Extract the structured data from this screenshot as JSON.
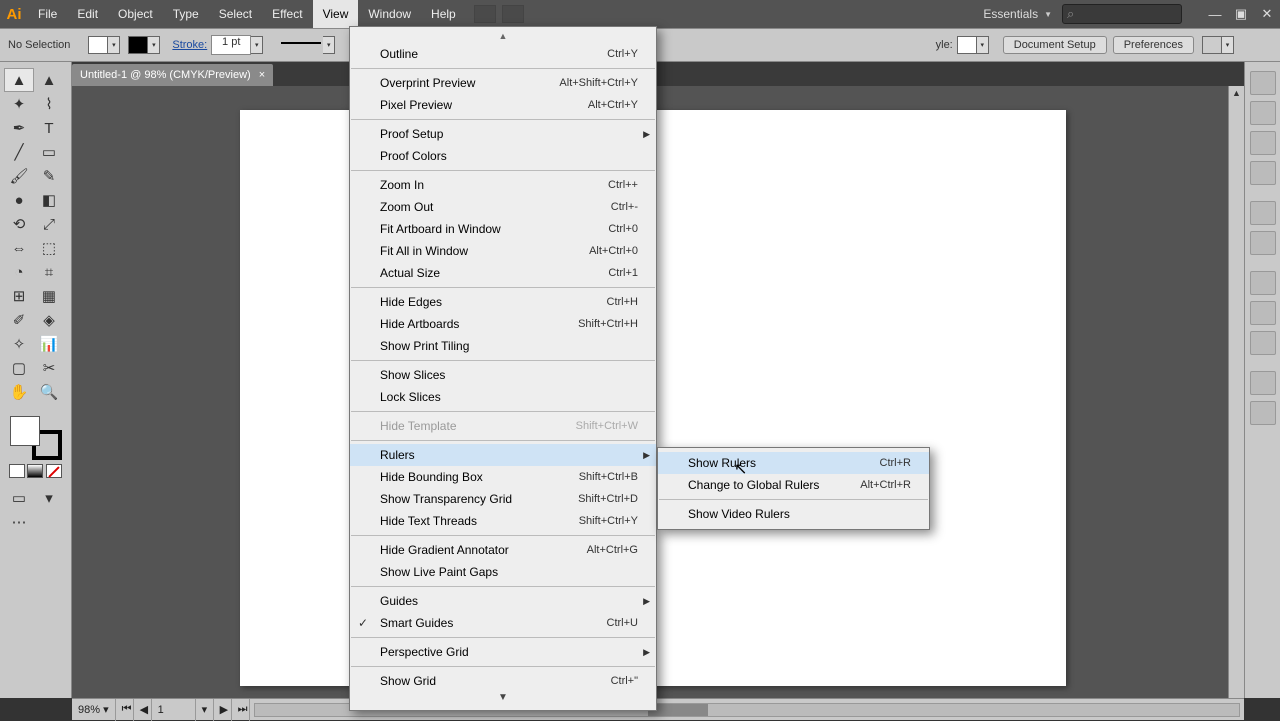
{
  "menubar": {
    "items": [
      "File",
      "Edit",
      "Object",
      "Type",
      "Select",
      "Effect",
      "View",
      "Window",
      "Help"
    ],
    "workspace": "Essentials"
  },
  "controlbar": {
    "selection": "No Selection",
    "stroke_label": "Stroke:",
    "stroke_val": "1 pt",
    "style_label": "yle:",
    "doc_setup": "Document Setup",
    "prefs": "Preferences"
  },
  "tab": {
    "title": "Untitled-1 @ 98% (CMYK/Preview)"
  },
  "status": {
    "zoom": "98%",
    "art": "1"
  },
  "view_menu": [
    {
      "t": "item",
      "label": "Outline",
      "cut": "Ctrl+Y"
    },
    {
      "t": "sep"
    },
    {
      "t": "item",
      "label": "Overprint Preview",
      "cut": "Alt+Shift+Ctrl+Y"
    },
    {
      "t": "item",
      "label": "Pixel Preview",
      "cut": "Alt+Ctrl+Y"
    },
    {
      "t": "sep"
    },
    {
      "t": "item",
      "label": "Proof Setup",
      "submenu": true
    },
    {
      "t": "item",
      "label": "Proof Colors"
    },
    {
      "t": "sep"
    },
    {
      "t": "item",
      "label": "Zoom In",
      "cut": "Ctrl++"
    },
    {
      "t": "item",
      "label": "Zoom Out",
      "cut": "Ctrl+-"
    },
    {
      "t": "item",
      "label": "Fit Artboard in Window",
      "cut": "Ctrl+0"
    },
    {
      "t": "item",
      "label": "Fit All in Window",
      "cut": "Alt+Ctrl+0"
    },
    {
      "t": "item",
      "label": "Actual Size",
      "cut": "Ctrl+1"
    },
    {
      "t": "sep"
    },
    {
      "t": "item",
      "label": "Hide Edges",
      "cut": "Ctrl+H"
    },
    {
      "t": "item",
      "label": "Hide Artboards",
      "cut": "Shift+Ctrl+H"
    },
    {
      "t": "item",
      "label": "Show Print Tiling"
    },
    {
      "t": "sep"
    },
    {
      "t": "item",
      "label": "Show Slices"
    },
    {
      "t": "item",
      "label": "Lock Slices"
    },
    {
      "t": "sep"
    },
    {
      "t": "item",
      "label": "Hide Template",
      "cut": "Shift+Ctrl+W",
      "disabled": true
    },
    {
      "t": "sep"
    },
    {
      "t": "item",
      "label": "Rulers",
      "submenu": true,
      "hl": true
    },
    {
      "t": "item",
      "label": "Hide Bounding Box",
      "cut": "Shift+Ctrl+B"
    },
    {
      "t": "item",
      "label": "Show Transparency Grid",
      "cut": "Shift+Ctrl+D"
    },
    {
      "t": "item",
      "label": "Hide Text Threads",
      "cut": "Shift+Ctrl+Y"
    },
    {
      "t": "sep"
    },
    {
      "t": "item",
      "label": "Hide Gradient Annotator",
      "cut": "Alt+Ctrl+G"
    },
    {
      "t": "item",
      "label": "Show Live Paint Gaps"
    },
    {
      "t": "sep"
    },
    {
      "t": "item",
      "label": "Guides",
      "submenu": true
    },
    {
      "t": "item",
      "label": "Smart Guides",
      "cut": "Ctrl+U",
      "check": true
    },
    {
      "t": "sep"
    },
    {
      "t": "item",
      "label": "Perspective Grid",
      "submenu": true
    },
    {
      "t": "sep"
    },
    {
      "t": "item",
      "label": "Show Grid",
      "cut": "Ctrl+\""
    }
  ],
  "rulers_submenu": [
    {
      "t": "item",
      "label": "Show Rulers",
      "cut": "Ctrl+R",
      "hl": true
    },
    {
      "t": "item",
      "label": "Change to Global Rulers",
      "cut": "Alt+Ctrl+R"
    },
    {
      "t": "sep"
    },
    {
      "t": "item",
      "label": "Show Video Rulers"
    }
  ]
}
